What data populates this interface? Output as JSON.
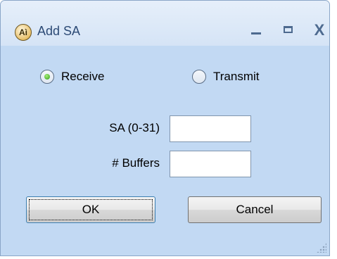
{
  "window": {
    "title": "Add SA",
    "icon": "app-logo-icon",
    "icon_text": "Aì",
    "controls": {
      "minimize": "minimize-icon",
      "maximize": "maximize-icon",
      "close": "X"
    }
  },
  "mode": {
    "options": [
      {
        "label": "Receive",
        "checked": true
      },
      {
        "label": "Transmit",
        "checked": false
      }
    ]
  },
  "fields": {
    "sa": {
      "label": "SA (0-31)",
      "value": ""
    },
    "buffers": {
      "label": "# Buffers",
      "value": ""
    }
  },
  "buttons": {
    "ok": "OK",
    "cancel": "Cancel"
  },
  "colors": {
    "window_bg": "#c2d9f3",
    "title_text": "#2c4a75",
    "radio_checked": "#2f9a18"
  }
}
